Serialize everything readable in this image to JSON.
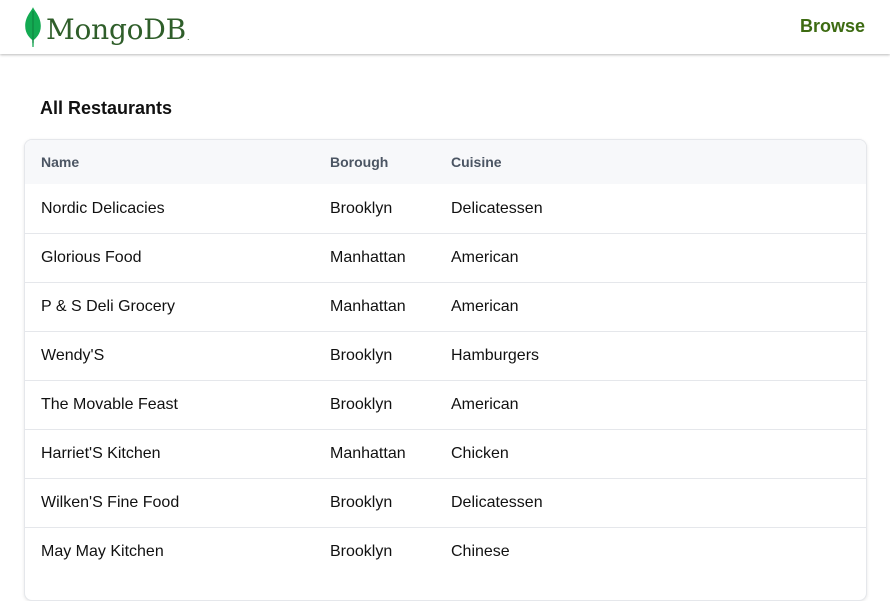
{
  "navbar": {
    "brand": "MongoDB",
    "brand_mark": ".",
    "browse_label": "Browse",
    "brand_color": "#2f5e2a",
    "leaf_color": "#13aa52",
    "link_color": "#3d6b12"
  },
  "page": {
    "title": "All Restaurants"
  },
  "table": {
    "headers": [
      "Name",
      "Borough",
      "Cuisine"
    ],
    "rows": [
      [
        "Nordic Delicacies",
        "Brooklyn",
        "Delicatessen"
      ],
      [
        "Glorious Food",
        "Manhattan",
        "American"
      ],
      [
        "P & S Deli Grocery",
        "Manhattan",
        "American"
      ],
      [
        "Wendy'S",
        "Brooklyn",
        "Hamburgers"
      ],
      [
        "The Movable Feast",
        "Brooklyn",
        "American"
      ],
      [
        "Harriet'S Kitchen",
        "Manhattan",
        "Chicken"
      ],
      [
        "Wilken'S Fine Food",
        "Brooklyn",
        "Delicatessen"
      ],
      [
        "May May Kitchen",
        "Brooklyn",
        "Chinese"
      ]
    ]
  }
}
